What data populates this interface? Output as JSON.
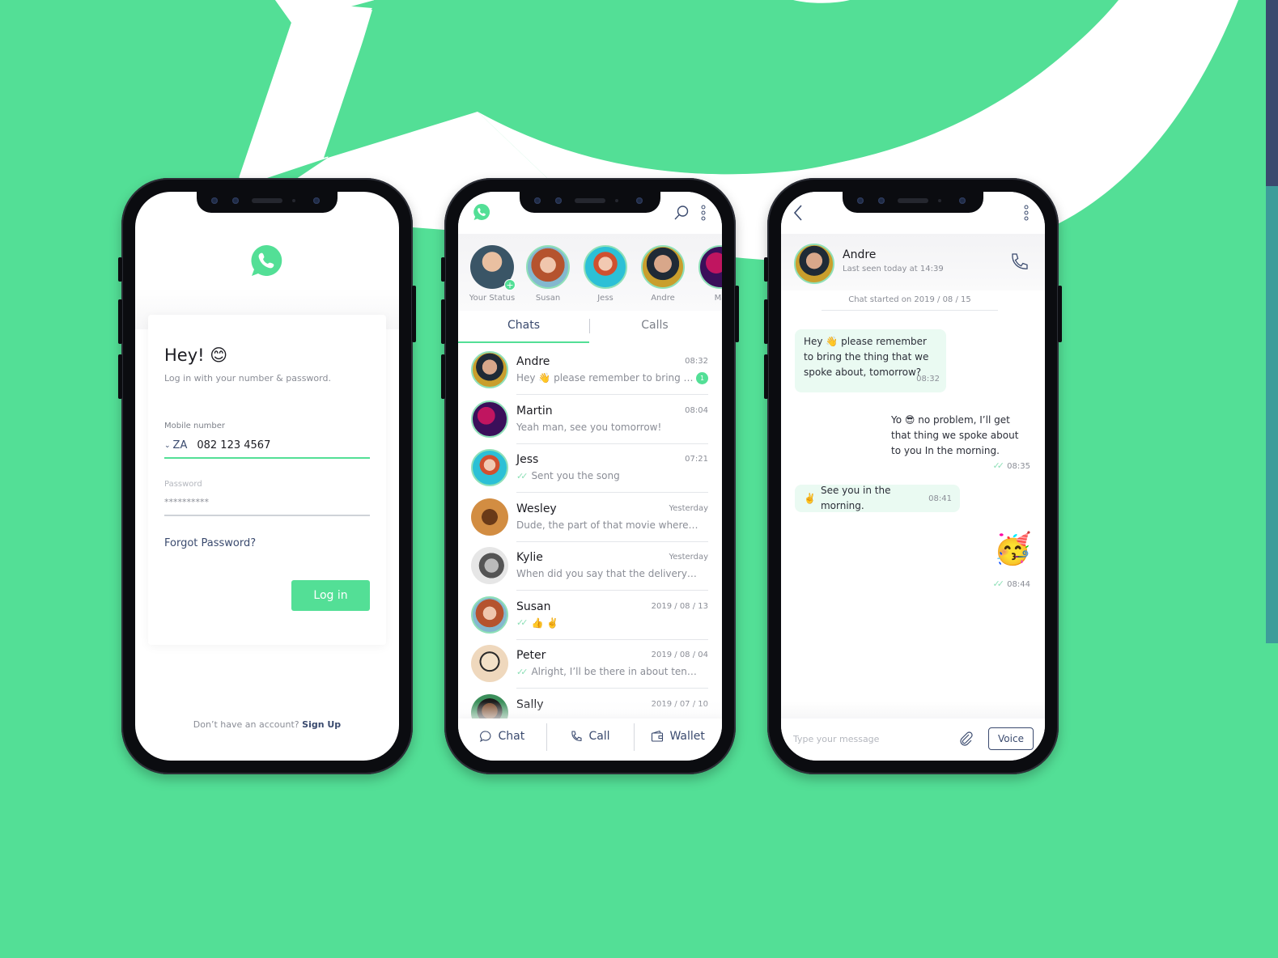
{
  "brand": {
    "accent": "#53df96",
    "navy": "#3a4a6e",
    "bubble": "#eafaf2"
  },
  "login": {
    "logo_icon": "whatsapp-logo-icon",
    "greeting": "Hey! 😊",
    "subtitle": "Log in with your number & password.",
    "mobile_label": "Mobile number",
    "country_code": "ZA",
    "mobile_value": "082 123 4567",
    "password_label": "Password",
    "password_value": "**********",
    "forgot_label": "Forgot Password?",
    "login_button": "Log in",
    "signup_prompt": "Don’t have an account?",
    "signup_link": "Sign Up"
  },
  "chats": {
    "stories": [
      {
        "label": "Your Status",
        "self": true
      },
      {
        "label": "Susan"
      },
      {
        "label": "Jess"
      },
      {
        "label": "Andre"
      },
      {
        "label": "Ma"
      }
    ],
    "tabs": [
      {
        "label": "Chats",
        "active": true
      },
      {
        "label": "Calls",
        "active": false
      }
    ],
    "list": [
      {
        "name": "Andre",
        "time": "08:32",
        "preview": "Hey 👋  please remember to bring …",
        "unread": "1",
        "ticks": false
      },
      {
        "name": "Martin",
        "time": "08:04",
        "preview": "Yeah man, see you tomorrow!",
        "ticks": false
      },
      {
        "name": "Jess",
        "time": "07:21",
        "preview": "Sent you the song",
        "ticks": true
      },
      {
        "name": "Wesley",
        "time": "Yesterday",
        "preview": "Dude, the part of that movie where…",
        "ticks": false
      },
      {
        "name": "Kylie",
        "time": "Yesterday",
        "preview": "When did you say that the delivery…",
        "ticks": false
      },
      {
        "name": "Susan",
        "time": "2019 / 08 / 13",
        "preview": "👍 ✌️",
        "ticks": true
      },
      {
        "name": "Peter",
        "time": "2019 / 08 / 04",
        "preview": "Alright, I’ll be there in about ten…",
        "ticks": true
      },
      {
        "name": "Sally",
        "time": "2019 / 07 / 10",
        "preview": "",
        "ticks": false
      }
    ],
    "nav": [
      {
        "label": "Chat"
      },
      {
        "label": "Call"
      },
      {
        "label": "Wallet"
      }
    ]
  },
  "conversation": {
    "contact_name": "Andre",
    "last_seen": "Last seen today at 14:39",
    "started": "Chat started on  2019 / 08 / 15",
    "messages": [
      {
        "dir": "in",
        "text": "Hey 👋  please remember to bring the thing that we spoke about, tomorrow?",
        "time": "08:32"
      },
      {
        "dir": "out",
        "text": "Yo 😎  no problem, I’ll get that thing we spoke about to you In the morning.",
        "time": "08:35",
        "tick": "✓✓"
      },
      {
        "dir": "in",
        "text": "See you in the morning.",
        "emoji": "✌️",
        "time": "08:41"
      },
      {
        "dir": "out",
        "text": "🥳",
        "time": "08:44",
        "tick": "✓✓"
      }
    ],
    "composer_placeholder": "Type your message",
    "voice_button": "Voice"
  }
}
